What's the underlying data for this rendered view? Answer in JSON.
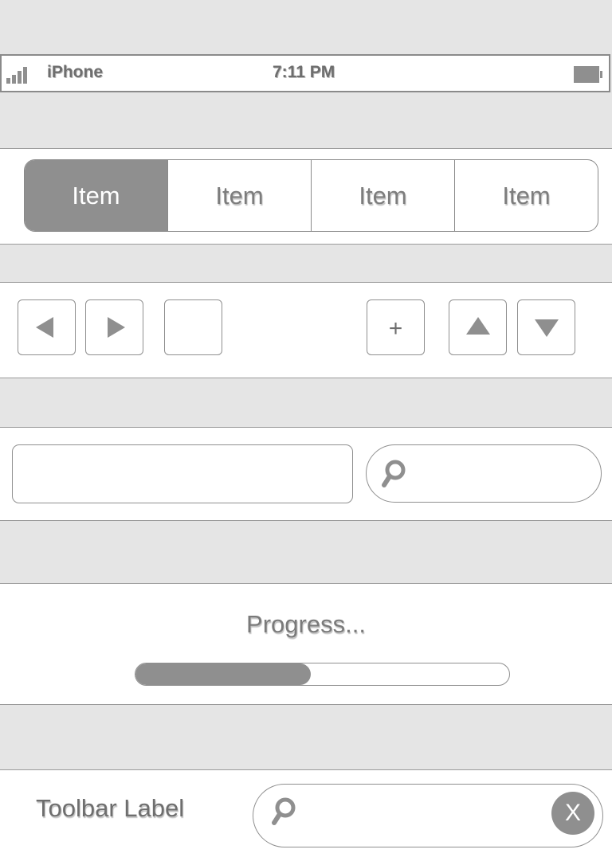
{
  "status_bar": {
    "carrier": "iPhone",
    "time": "7:11 PM",
    "signal_icon": "signal-bars-icon",
    "battery_icon": "battery-icon"
  },
  "segmented_control": {
    "selected_index": 0,
    "items": [
      {
        "label": "Item"
      },
      {
        "label": "Item"
      },
      {
        "label": "Item"
      },
      {
        "label": "Item"
      }
    ]
  },
  "buttons": {
    "back_icon": "triangle-left-icon",
    "forward_icon": "triangle-right-icon",
    "add_label": "+",
    "up_icon": "triangle-up-icon",
    "down_icon": "triangle-down-icon"
  },
  "fields": {
    "text_value": "",
    "search_value": "",
    "search_icon": "magnifier-icon"
  },
  "progress": {
    "label": "Progress...",
    "fraction": 0.47
  },
  "toolbar": {
    "label": "Toolbar Label",
    "search_value": "",
    "clear_label": "X"
  },
  "colors": {
    "background": "#e5e5e5",
    "fill": "#8f8f8f",
    "stroke": "#8a8a8a",
    "text": "#7d7d7d"
  }
}
